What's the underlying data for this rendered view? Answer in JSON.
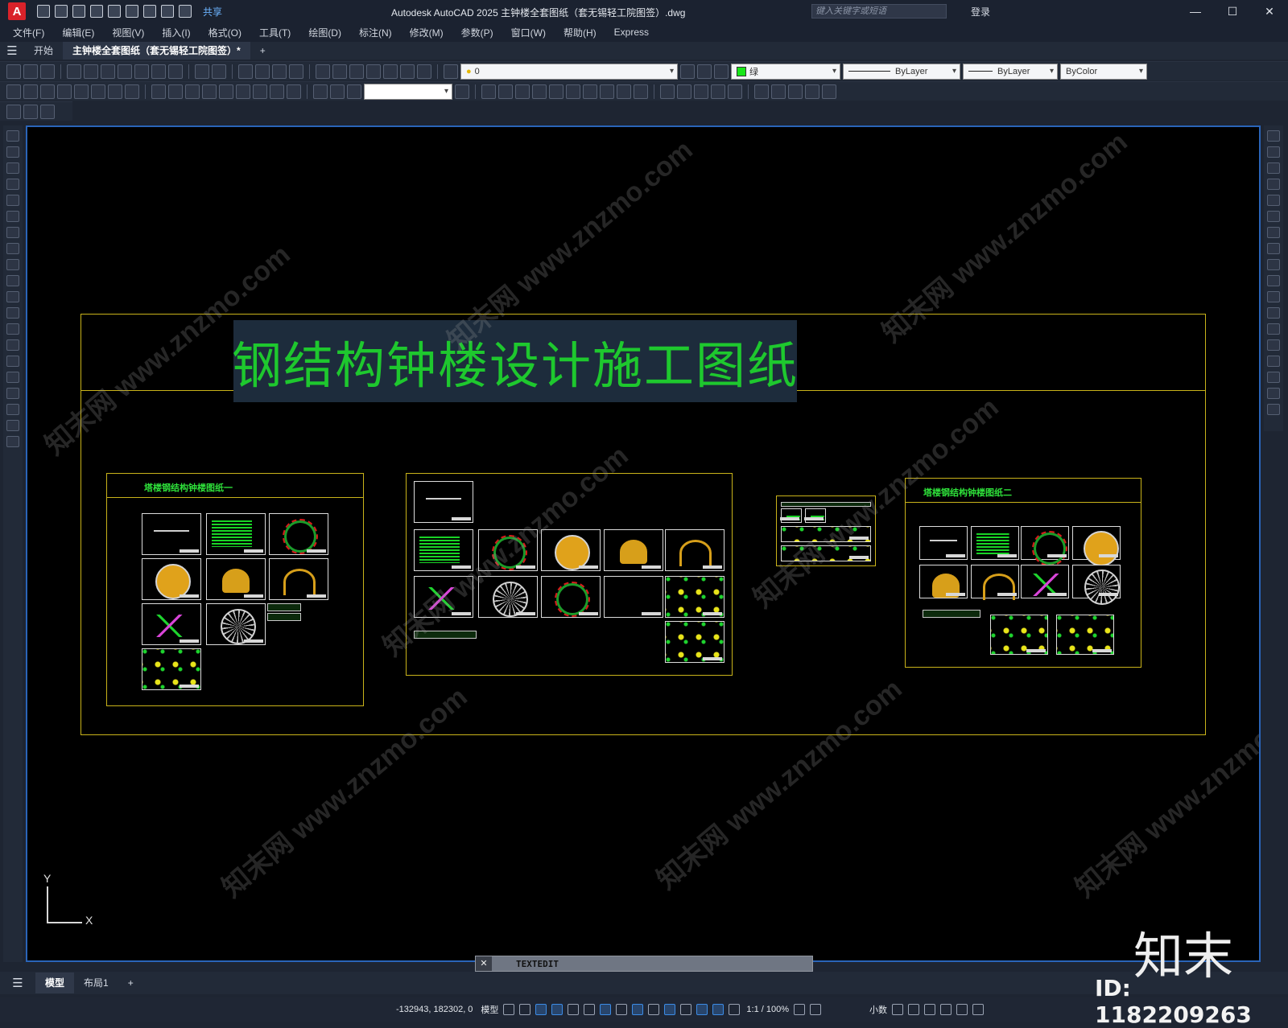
{
  "titlebar": {
    "app_logo": "A",
    "share_label": "共享",
    "window_title": "Autodesk AutoCAD 2025    主钟楼全套图纸（套无锡轻工院图签）.dwg",
    "search_placeholder": "键入关键字或短语",
    "login_label": "登录"
  },
  "menu": [
    "文件(F)",
    "编辑(E)",
    "视图(V)",
    "插入(I)",
    "格式(O)",
    "工具(T)",
    "绘图(D)",
    "标注(N)",
    "修改(M)",
    "参数(P)",
    "窗口(W)",
    "帮助(H)",
    "Express"
  ],
  "doc_tabs": {
    "start": "开始",
    "active": "主钟楼全套图纸（套无锡轻工院图签）*",
    "add": "+"
  },
  "properties": {
    "layer": "0",
    "color_label": "绿",
    "color_hex": "#19e619",
    "linetype": "ByLayer",
    "lineweight": "ByLayer",
    "plotstyle": "ByColor"
  },
  "drawing": {
    "main_title": "钢结构钟楼设计施工图纸",
    "sheet1_title": "塔楼钢结构钟楼图纸一",
    "sheet2_title": "塔楼钢结构钟楼图纸二",
    "ucs_x": "X",
    "ucs_y": "Y"
  },
  "command_line": {
    "close": "✕",
    "text": "TEXTEDIT"
  },
  "layout_tabs": {
    "model": "模型",
    "layout1": "布局1",
    "add": "+"
  },
  "status": {
    "coords": "-132943, 182302, 0",
    "model": "模型",
    "scale": "1:1 / 100%",
    "units": "小数"
  },
  "overlay": {
    "brand": "知末",
    "id": "ID: 1182209263",
    "watermark": "知末网 www.znzmo.com"
  }
}
